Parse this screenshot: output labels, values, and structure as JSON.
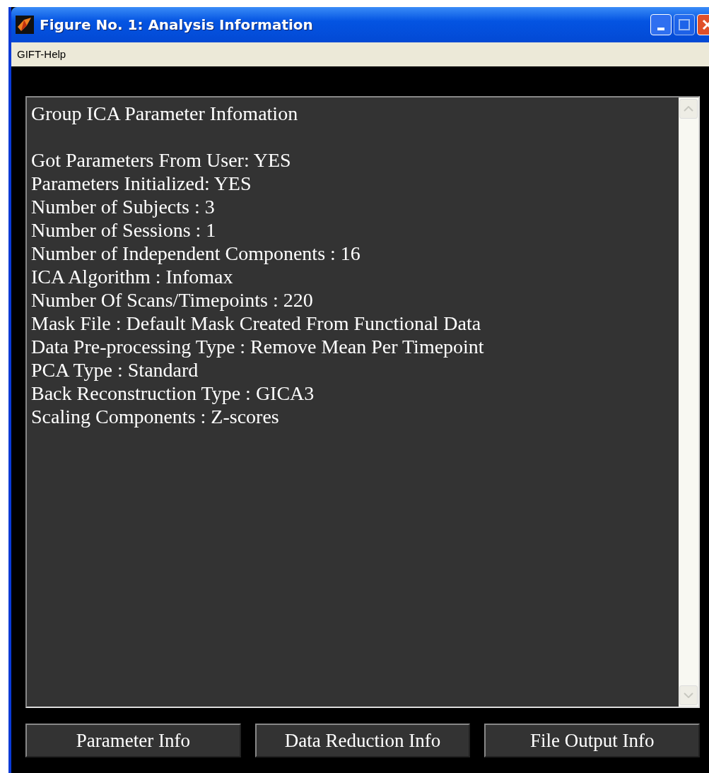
{
  "window": {
    "title": "Figure No. 1: Analysis Information"
  },
  "menu": [
    "GIFT-Help"
  ],
  "heading": "Group ICA Parameter Infomation",
  "text_lines": [
    "Got Parameters From User: YES",
    "Parameters Initialized: YES",
    "Number of Subjects : 3",
    "Number of Sessions : 1",
    "Number of Independent Components : 16",
    "ICA Algorithm : Infomax",
    "Number Of Scans/Timepoints : 220",
    "Mask File : Default Mask Created From Functional Data",
    "Data Pre-processing Type : Remove Mean Per Timepoint",
    "PCA Type : Standard",
    "Back Reconstruction Type : GICA3",
    "Scaling Components : Z-scores"
  ],
  "buttons": [
    "Parameter Info",
    "Data Reduction Info",
    "File Output Info"
  ]
}
